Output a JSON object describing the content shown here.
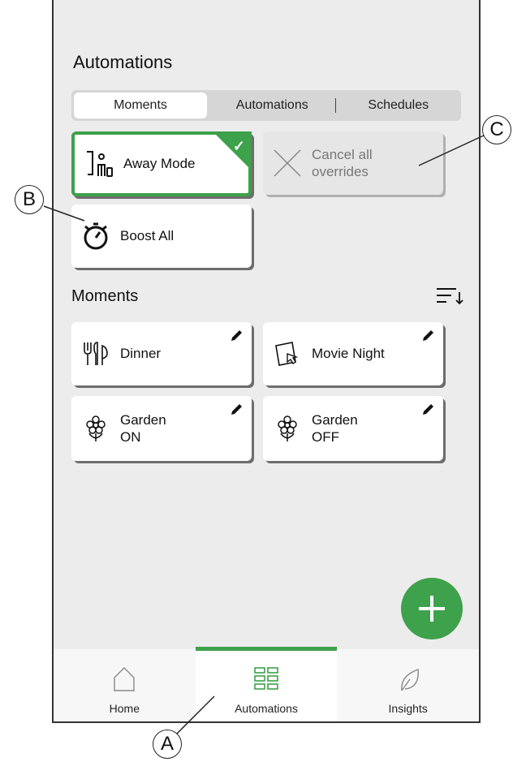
{
  "header": {
    "title": "Automations"
  },
  "segments": {
    "tabs": [
      {
        "label": "Moments",
        "active": true
      },
      {
        "label": "Automations",
        "active": false
      },
      {
        "label": "Schedules",
        "active": false
      }
    ]
  },
  "quick_actions": {
    "away_mode": {
      "label": "Away Mode",
      "selected": true,
      "icon": "away-person-icon"
    },
    "cancel_overrides": {
      "label": "Cancel all overrides",
      "line1": "Cancel all",
      "line2": "overrides",
      "enabled": false,
      "icon": "x-cross-icon"
    },
    "boost_all": {
      "label": "Boost All",
      "icon": "stopwatch-boost-icon"
    }
  },
  "moments": {
    "title": "Moments",
    "sort_icon": "sort-icon",
    "items": [
      {
        "line1": "Dinner",
        "line2": "",
        "icon": "cutlery-icon"
      },
      {
        "line1": "Movie Night",
        "line2": "",
        "icon": "tablet-touch-icon"
      },
      {
        "line1": "Garden",
        "line2": "ON",
        "icon": "flower-icon"
      },
      {
        "line1": "Garden",
        "line2": "OFF",
        "icon": "flower-icon"
      }
    ]
  },
  "fab": {
    "icon": "plus-icon"
  },
  "nav": {
    "items": [
      {
        "label": "Home",
        "icon": "house-icon",
        "active": false
      },
      {
        "label": "Automations",
        "icon": "grid-icon",
        "active": true
      },
      {
        "label": "Insights",
        "icon": "leaf-icon",
        "active": false
      }
    ]
  },
  "callouts": {
    "a": "A",
    "b": "B",
    "c": "C"
  },
  "colors": {
    "accent": "#3ea14b",
    "background": "#ececec",
    "card": "#ffffff"
  }
}
